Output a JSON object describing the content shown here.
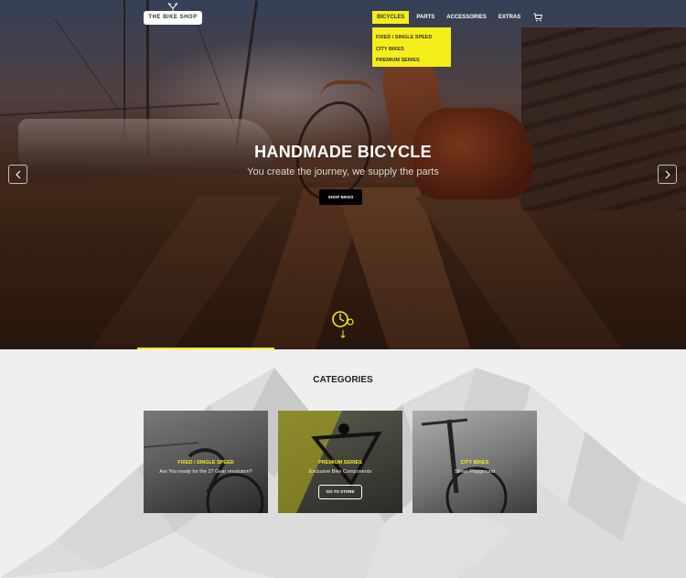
{
  "brand": {
    "logo_text": "THE BIKE SHOP"
  },
  "nav": {
    "items": [
      {
        "label": "BICYCLES"
      },
      {
        "label": "PARTS"
      },
      {
        "label": "ACCESSORIES"
      },
      {
        "label": "EXTRAS"
      }
    ],
    "cart_icon": "cart-icon"
  },
  "dropdown": {
    "items": [
      {
        "label": "FIXED / SINGLE SPEED"
      },
      {
        "label": "CITY BIKES"
      },
      {
        "label": "PREMIUM SERIES"
      }
    ]
  },
  "hero": {
    "title": "HANDMADE BICYCLE",
    "subtitle": "You create the journey, we supply the parts",
    "button_label": "SHOP BIKES",
    "prev_icon": "chevron-left-icon",
    "next_icon": "chevron-right-icon",
    "scroll_icon": "scroll-down-icon"
  },
  "categories": {
    "title": "CATEGORIES",
    "cards": [
      {
        "title": "FIXED / SINGLE SPEED",
        "text": "Are You ready for the 27 Gear revolution?"
      },
      {
        "title": "PREMIUM SERIES",
        "text": "Exclusive Bike Components",
        "button_label": "GO TO STORE"
      },
      {
        "title": "CITY BIKES",
        "text": "Street Playground"
      }
    ]
  },
  "colors": {
    "accent": "#f5ee1b",
    "button_dark": "#000000",
    "section_bg": "#efefef"
  }
}
